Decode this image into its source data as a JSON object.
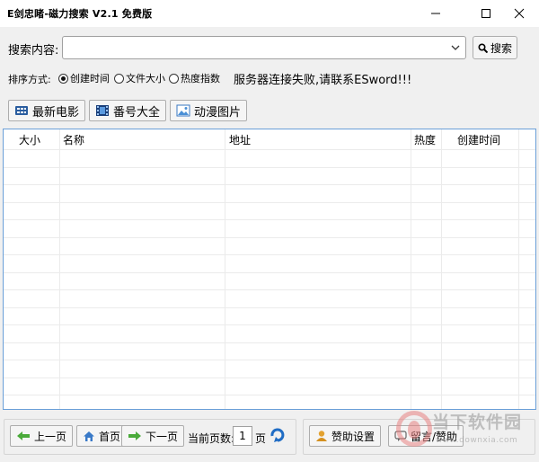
{
  "window": {
    "title": "E剑忠睹-磁力搜索 V2.1 免费版"
  },
  "search": {
    "label": "搜索内容:",
    "value": "",
    "button": "搜索"
  },
  "sort": {
    "label": "排序方式:",
    "options": [
      {
        "label": "创建时间",
        "checked": true
      },
      {
        "label": "文件大小",
        "checked": false
      },
      {
        "label": "热度指数",
        "checked": false
      }
    ]
  },
  "status_message": "服务器连接失败,请联系ESword!!!",
  "toolbar": {
    "movies": "最新电影",
    "codes": "番号大全",
    "anime": "动漫图片"
  },
  "table": {
    "columns": [
      "大小",
      "名称",
      "地址",
      "热度",
      "创建时间"
    ],
    "rows": []
  },
  "pager": {
    "prev": "上一页",
    "home": "首页",
    "next": "下一页",
    "current_label": "当前页数:",
    "current_page": "1",
    "page_unit": "页"
  },
  "support": {
    "sponsor_settings": "赞助设置",
    "message_sponsor": "留言/赞助"
  },
  "watermark": {
    "name": "当下软件园",
    "url": "www.downxia.com"
  }
}
